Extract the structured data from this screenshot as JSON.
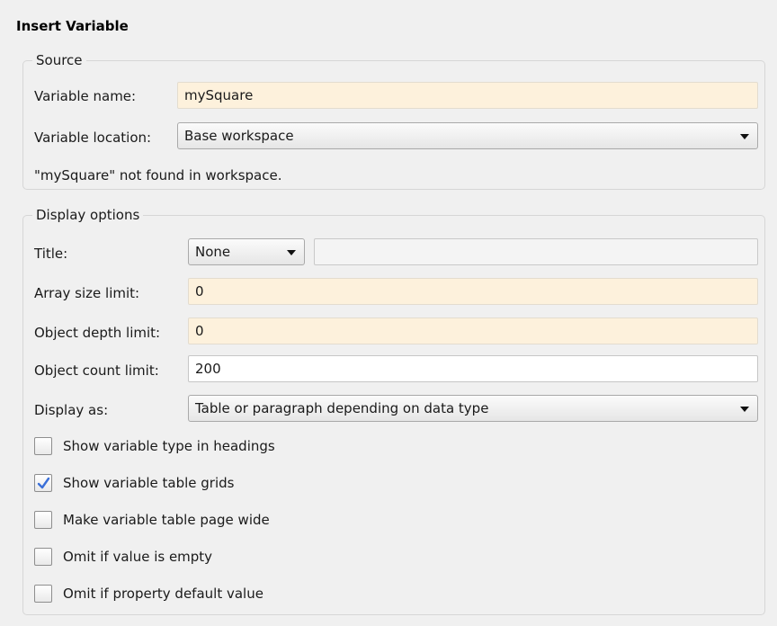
{
  "dialog": {
    "title": "Insert Variable"
  },
  "source": {
    "label": "Source",
    "variable_name_label": "Variable name:",
    "variable_name_value": "mySquare",
    "variable_location_label": "Variable location:",
    "variable_location_value": "Base workspace",
    "status_message": "\"mySquare\" not found in workspace."
  },
  "display": {
    "label": "Display options",
    "title_label": "Title:",
    "title_select_value": "None",
    "title_text_value": "",
    "array_size_label": "Array size limit:",
    "array_size_value": "0",
    "object_depth_label": "Object depth limit:",
    "object_depth_value": "0",
    "object_count_label": "Object count limit:",
    "object_count_value": "200",
    "display_as_label": "Display as:",
    "display_as_value": "Table or paragraph depending on data type",
    "checkboxes": [
      {
        "label": "Show variable type in headings",
        "checked": false
      },
      {
        "label": "Show variable table grids",
        "checked": true
      },
      {
        "label": "Make variable table page wide",
        "checked": false
      },
      {
        "label": "Omit if value is empty",
        "checked": false
      },
      {
        "label": "Omit if property default value",
        "checked": false
      }
    ]
  },
  "colors": {
    "required_field_bg": "#fdf1dc",
    "checkmark": "#3a6fd8"
  },
  "icons": {
    "dropdown": "chevron-down-icon",
    "check": "checkmark-icon"
  }
}
